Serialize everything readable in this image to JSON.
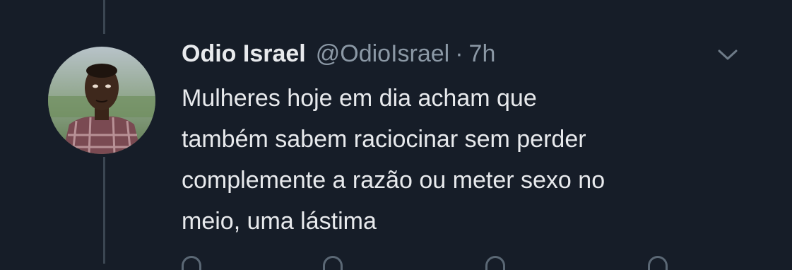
{
  "tweet": {
    "display_name": "Odio Israel",
    "handle": "@OdioIsrael",
    "separator": "·",
    "time": "7h",
    "text_lines": [
      "Mulheres hoje em dia acham que",
      "também sabem raciocinar sem perder",
      "complemente a razão ou meter sexo no",
      "meio, uma lástima"
    ]
  },
  "icons": {
    "menu": "chevron-down-icon",
    "avatar": "avatar"
  },
  "colors": {
    "background": "#161d28",
    "text": "#e8eaed",
    "secondary_text": "#8b98a5",
    "thread_line": "#3b4652"
  }
}
